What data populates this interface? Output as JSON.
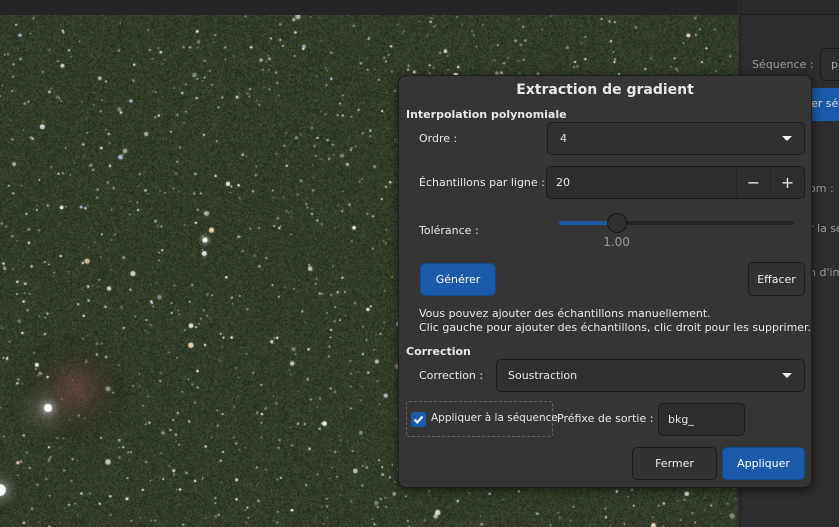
{
  "background_panel": {
    "sequence_label": "Séquence :",
    "sequence_value": "p",
    "button_partial": "er séq",
    "label_partial_1": "om :",
    "label_partial_2": "r la se",
    "label_partial_3": "n d'im"
  },
  "dialog": {
    "title": "Extraction de gradient",
    "interpolation": {
      "heading": "Interpolation polynomiale",
      "order_label": "Ordre :",
      "order_value": "4",
      "samples_label": "Échantillons par ligne :",
      "samples_value": "20",
      "minus": "−",
      "plus": "+",
      "tolerance_label": "Tolérance :",
      "tolerance_value": "1.00",
      "tolerance_fraction": 0.245,
      "generate_label": "Générer",
      "clear_label": "Effacer",
      "hint_line1": "Vous pouvez ajouter des échantillons manuellement.",
      "hint_line2": "Clic gauche pour ajouter des échantillons, clic droit pour les supprimer."
    },
    "correction": {
      "heading": "Correction",
      "correction_label": "Correction :",
      "correction_value": "Soustraction",
      "apply_sequence_label": "Appliquer à la séquence",
      "apply_sequence_checked": true,
      "prefix_label": "Préfixe de sortie :",
      "prefix_value": "bkg_"
    },
    "close_label": "Fermer",
    "apply_label": "Appliquer"
  }
}
